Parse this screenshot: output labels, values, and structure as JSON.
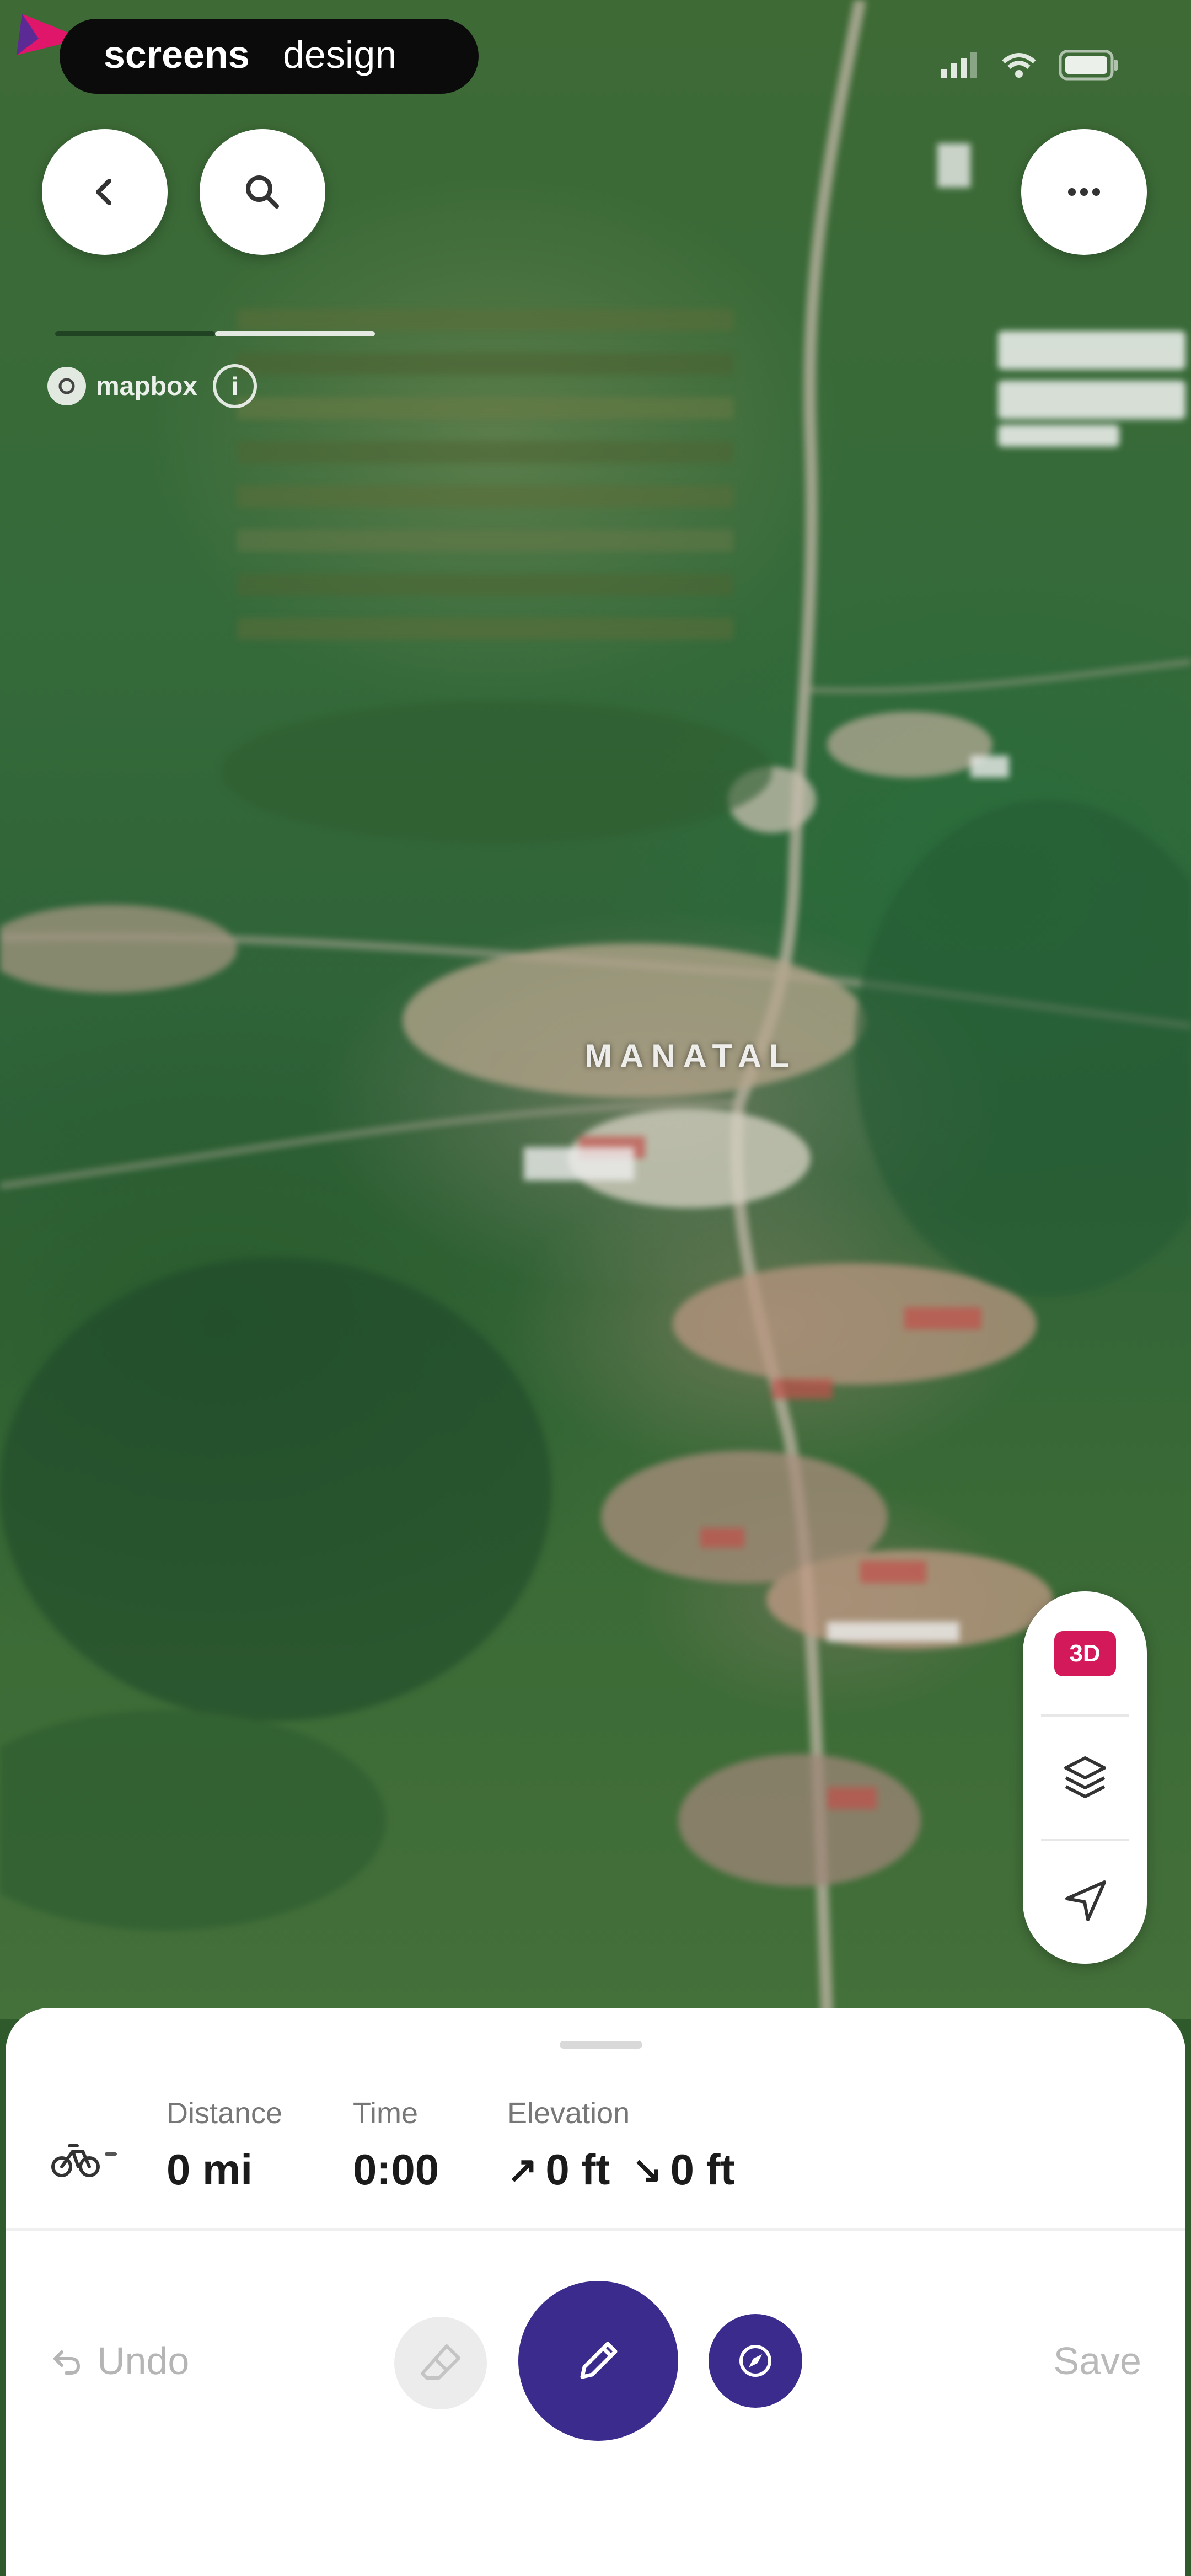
{
  "watermark": {
    "text_bold": "screens",
    "text_light": "design"
  },
  "map": {
    "provider_label": "mapbox",
    "info_label": "i",
    "place_label": "MANATAL",
    "marker_color": "#e0166a"
  },
  "top_buttons": {
    "back_icon": "chevron-left-icon",
    "search_icon": "search-icon",
    "more_icon": "more-horizontal-icon"
  },
  "map_controls": {
    "view_mode_label": "3D",
    "layers_icon": "layers-icon",
    "locate_icon": "navigation-arrow-icon",
    "accent": "#d3195a"
  },
  "route_summary": {
    "activity_icon": "cycling-icon",
    "distance": {
      "label": "Distance",
      "value": "0 mi"
    },
    "time": {
      "label": "Time",
      "value": "0:00"
    },
    "elevation": {
      "label": "Elevation",
      "gain": "0 ft",
      "loss": "0 ft"
    }
  },
  "actions": {
    "undo_label": "Undo",
    "save_label": "Save",
    "primary_color": "#3a2b8c"
  }
}
